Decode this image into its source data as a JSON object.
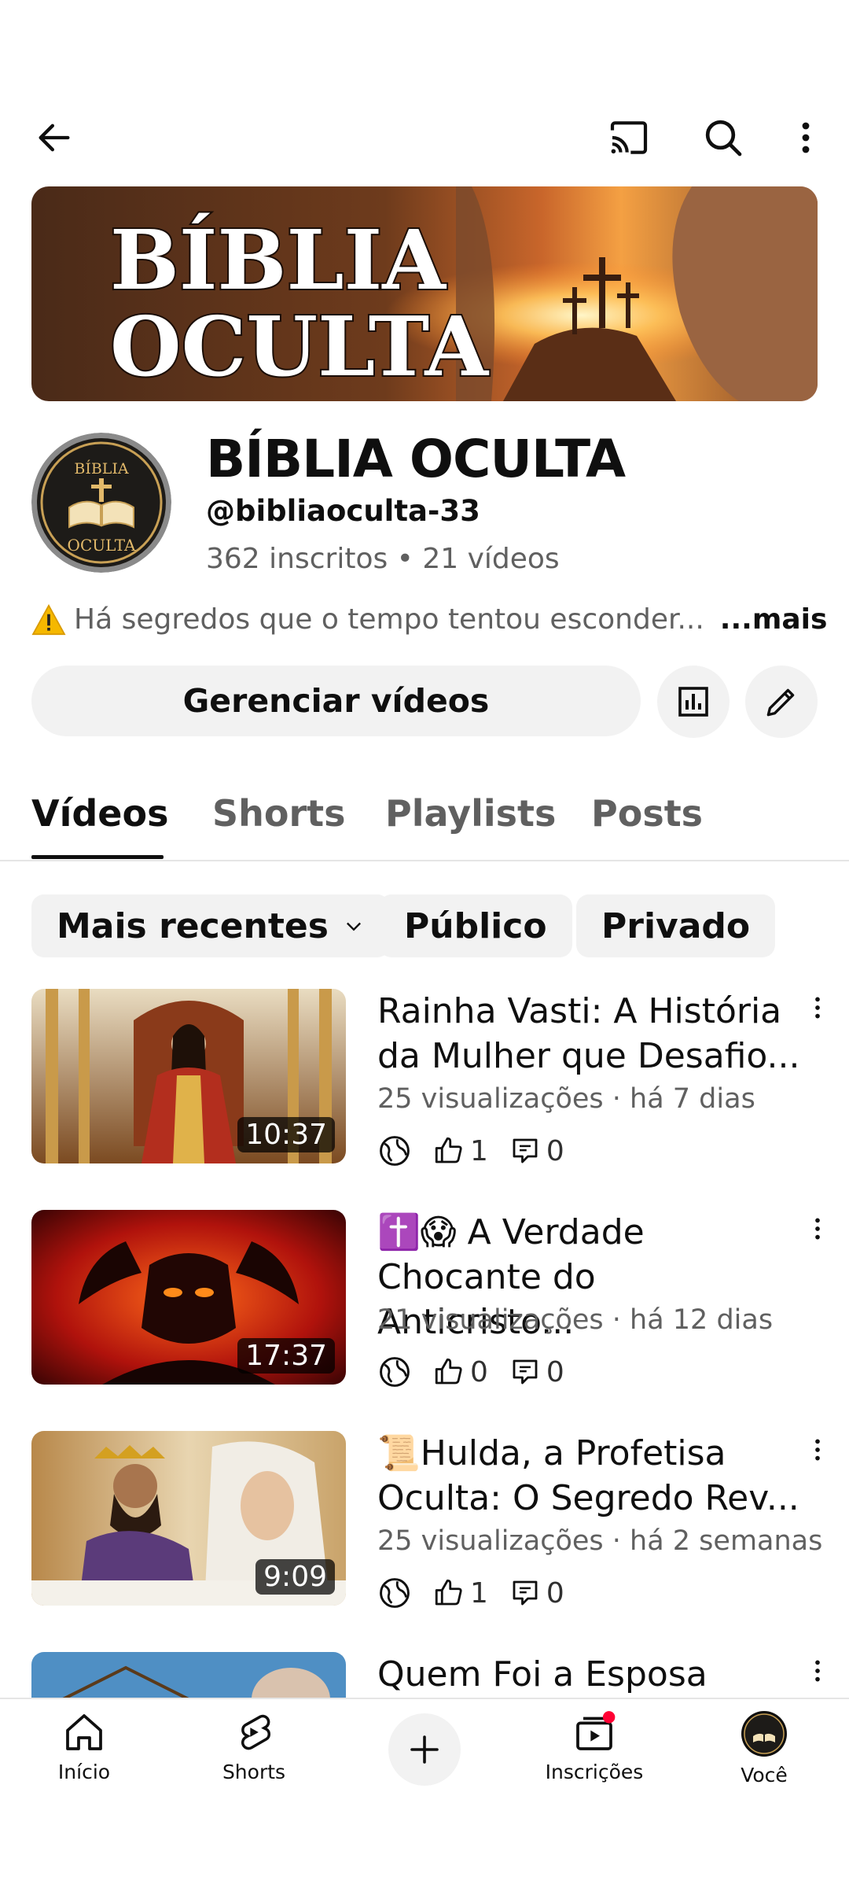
{
  "channel": {
    "banner_line1": "BÍBLIA",
    "banner_line2": "OCULTA",
    "avatar_line1": "BÍBLIA",
    "avatar_line2": "OCULTA",
    "name": "BÍBLIA OCULTA",
    "handle": "@bibliaoculta-33",
    "stats": "362 inscritos • 21 vídeos",
    "description": "Há segredos que o tempo tentou esconder...",
    "description_more": "...mais"
  },
  "actions": {
    "manage_label": "Gerenciar vídeos"
  },
  "tabs": [
    {
      "label": "Vídeos",
      "active": true
    },
    {
      "label": "Shorts"
    },
    {
      "label": "Playlists"
    },
    {
      "label": "Posts"
    }
  ],
  "filters": {
    "sort_label": "Mais recentes",
    "public_label": "Público",
    "private_label": "Privado"
  },
  "videos": [
    {
      "title": "Rainha Vasti: A História da Mulher que Desafio...",
      "meta": "25 visualizações · há 7 dias",
      "duration": "10:37",
      "likes": "1",
      "comments": "0"
    },
    {
      "title": "✝️😱 A Verdade Chocante do Anticristo...",
      "meta": "21 visualizações · há 12 dias",
      "duration": "17:37",
      "likes": "0",
      "comments": "0"
    },
    {
      "title": "📜Hulda, a Profetisa Oculta: O Segredo Rev...",
      "meta": "25 visualizações · há 2 semanas",
      "duration": "9:09",
      "likes": "1",
      "comments": "0"
    },
    {
      "title": "Quem Foi a Esposa"
    }
  ],
  "nav": [
    {
      "label": "Início",
      "icon": "home-icon"
    },
    {
      "label": "Shorts",
      "icon": "shorts-icon"
    },
    {
      "label": "",
      "icon": "create-icon"
    },
    {
      "label": "Inscrições",
      "icon": "subscriptions-icon"
    },
    {
      "label": "Você",
      "icon": "avatar"
    }
  ],
  "colors": {
    "text": "#0f0f0f",
    "secondary": "#606060",
    "chip": "#f2f2f2",
    "notification": "#ff0033"
  }
}
